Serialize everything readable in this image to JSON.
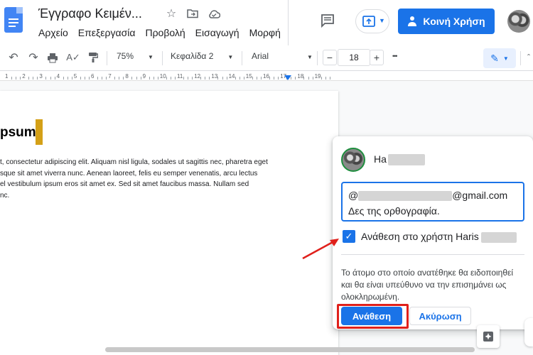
{
  "header": {
    "doc_title": "Έγγραφο Κειμέν...",
    "menu": [
      "Αρχείο",
      "Επεξεργασία",
      "Προβολή",
      "Εισαγωγή",
      "Μορφή"
    ],
    "share_label": "Κοινή Χρήση"
  },
  "toolbar": {
    "zoom": "75%",
    "style": "Κεφαλίδα 2",
    "font": "Arial",
    "font_size": "18",
    "minus": "−",
    "plus": "+",
    "more": "•••"
  },
  "ruler": {
    "numbers": [
      "1",
      "2",
      "3",
      "4",
      "5",
      "6",
      "7",
      "8",
      "9",
      "10",
      "11",
      "12",
      "13",
      "14",
      "15",
      "16",
      "17",
      "18",
      "19"
    ]
  },
  "document": {
    "heading": "psum",
    "lines": [
      "t, consectetur adipiscing elit. Aliquam nisl ligula, sodales ut sagittis  nec, pharetra eget",
      "sque sit amet viverra nunc. Aenean laoreet, felis eu semper   venenatis, arcu lectus",
      "el vestibulum ipsum eros sit amet ex. Sed sit amet faucibus  massa. Nullam sed",
      "nc."
    ]
  },
  "comment": {
    "author_visible": "Ha",
    "input_prefix": "@",
    "input_email_suffix": "@gmail.com",
    "input_text": "Δες της ορθογραφία.",
    "assign_label": "Ανάθεση στο χρήστη Haris",
    "note": "Το άτομο στο οποίο ανατέθηκε θα ειδοποιηθεί και θα είναι υπεύθυνο να την επισημάνει ως ολοκληρωμένη.",
    "assign_button": "Ανάθεση",
    "cancel_button": "Ακύρωση"
  },
  "colors": {
    "accent": "#1a73e8",
    "highlight_red": "#e0201b",
    "cursor_gold": "#d4a017"
  }
}
